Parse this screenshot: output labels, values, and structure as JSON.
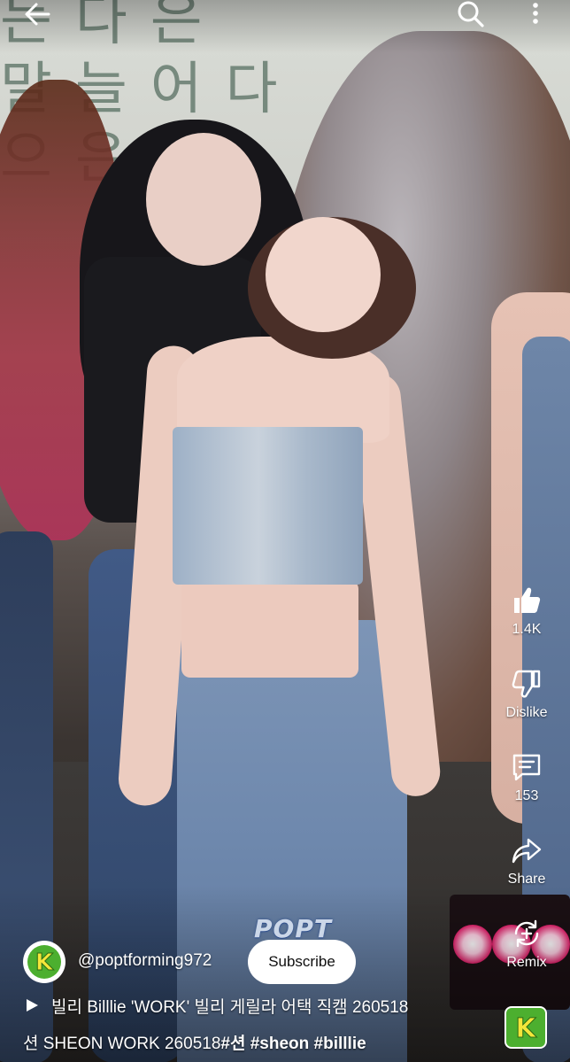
{
  "video": {
    "wall_text": "는다은\n말늘어다\n으은",
    "watermark": "POPT"
  },
  "topbar": {
    "back_icon": "arrow-left-icon",
    "search_icon": "search-icon",
    "more_icon": "more-vertical-icon"
  },
  "actions": {
    "like": {
      "icon": "thumbs-up-icon",
      "label": "1.4K"
    },
    "dislike": {
      "icon": "thumbs-down-icon",
      "label": "Dislike"
    },
    "comments": {
      "icon": "comment-icon",
      "label": "153"
    },
    "share": {
      "icon": "share-icon",
      "label": "Share"
    },
    "remix": {
      "icon": "remix-icon",
      "label": "Remix"
    }
  },
  "channel": {
    "avatar_letter": "K",
    "name": "@poptforming972",
    "subscribe_label": "Subscribe"
  },
  "video_info": {
    "title": "빌리 Billlie 'WORK' 빌리 게릴라 어택 직캠 260518",
    "description_prefix": "션 SHEON WORK 260518",
    "hashtags": "#션 #sheon #billlie"
  },
  "colors": {
    "avatar_green": "#4caf2f",
    "subscribe_bg": "#ffffff"
  }
}
